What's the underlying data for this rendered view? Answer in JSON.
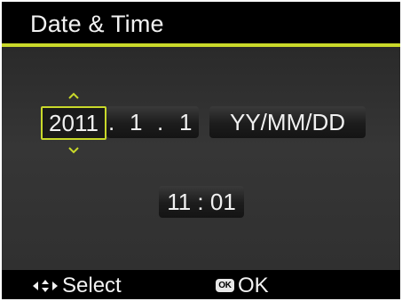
{
  "title": "Date & Time",
  "date": {
    "year": "2011",
    "separator1": ".",
    "month": "1",
    "separator2": ".",
    "day": "1",
    "format": "YY/MM/DD"
  },
  "time": {
    "value": "11 : 01"
  },
  "footer": {
    "select_label": "Select",
    "ok_badge": "OK",
    "ok_label": "OK"
  },
  "colors": {
    "accent": "#c9d92a",
    "background": "#000000",
    "text": "#f0f0f0"
  },
  "icons": {
    "year_up": "chevron-up-icon",
    "year_down": "chevron-down-icon",
    "select": "dpad-icon",
    "ok": "ok-button-icon"
  }
}
